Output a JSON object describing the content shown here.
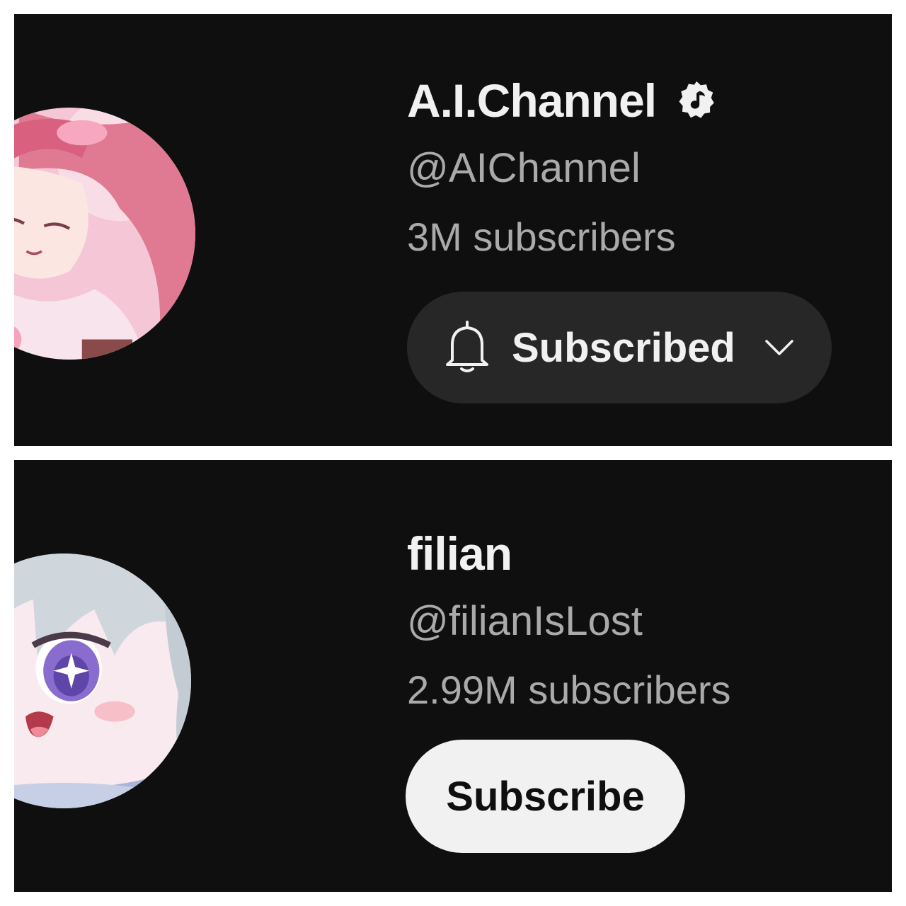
{
  "channels": [
    {
      "name": "A.I.Channel",
      "verified_icon": "music-note-verified-icon",
      "handle": "@AIChannel",
      "subscribers": "3M subscribers",
      "button": {
        "label": "Subscribed",
        "state": "subscribed",
        "icons": [
          "bell-icon",
          "chevron-down-icon"
        ]
      },
      "avatar_colors": {
        "background": "#f4c6d6",
        "hair": "#e07a93"
      }
    },
    {
      "name": "filian",
      "handle": "@filianIsLost",
      "subscribers": "2.99M subscribers",
      "button": {
        "label": "Subscribe",
        "state": "not-subscribed"
      },
      "avatar_colors": {
        "background": "#f8eaee",
        "hair": "#cfd7dd",
        "eyes": "#8a6ccf"
      }
    }
  ],
  "colors": {
    "panel_background": "#0f0f0f",
    "primary_text": "#f1f1f1",
    "secondary_text": "#aaaaaa",
    "subscribed_button": "#272727",
    "subscribe_button": "#f1f1f1"
  }
}
